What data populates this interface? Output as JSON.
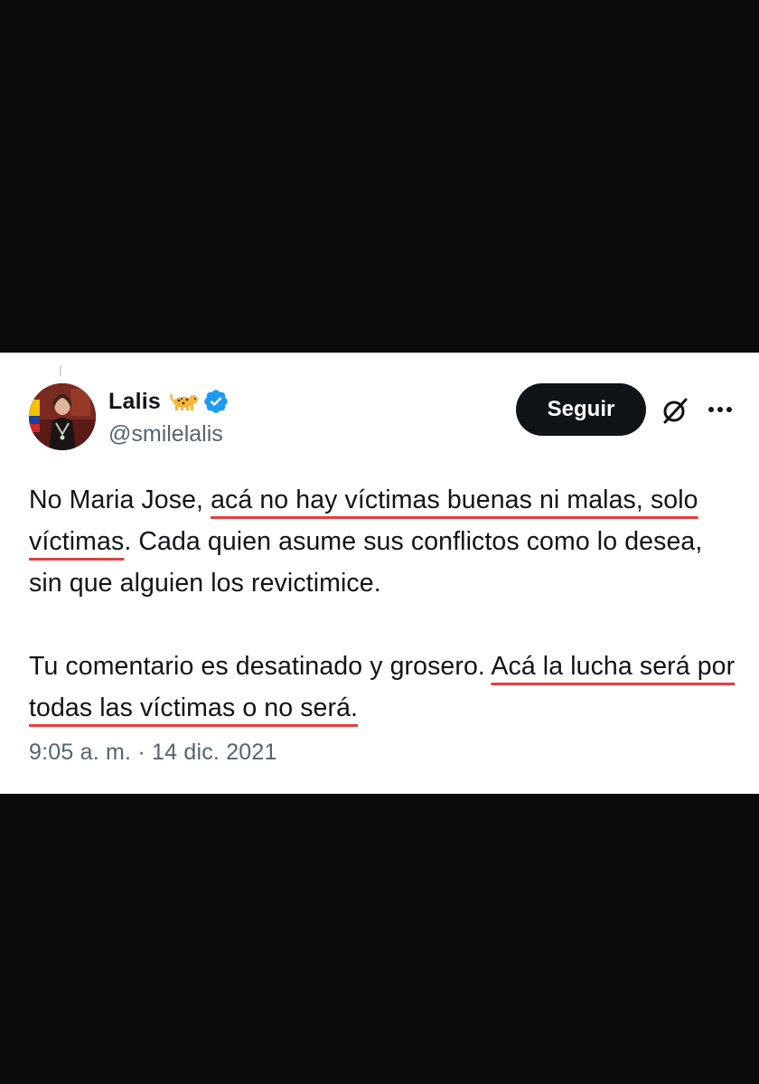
{
  "tweet": {
    "display_name": "Lalis",
    "name_emoji": "leopard-emoji",
    "verified_icon": "verified-badge-icon",
    "handle": "@smilelalis",
    "follow_label": "Seguir",
    "grok_icon": "grok-icon",
    "more_icon": "more-options-icon",
    "paragraph1": {
      "part1": "No Maria Jose, ",
      "part2": "acá no hay víctimas buenas ni malas, solo víctimas",
      "part3": ". Cada quien asume sus conflictos como lo desea, sin que alguien los revictimice."
    },
    "paragraph2": {
      "part1": "Tu comentario es desatinado y grosero. ",
      "part2": "Acá la lucha será por todas las víctimas o no será.",
      "part3": ""
    },
    "timestamp": "9:05 a. m. · 14 dic. 2021"
  },
  "colors": {
    "background": "#0b0b0c",
    "card": "#ffffff",
    "text": "#0f1419",
    "secondary_text": "#536471",
    "verified": "#1d9bf0",
    "follow_button": "#0f1419",
    "underline": "#e0413a"
  }
}
